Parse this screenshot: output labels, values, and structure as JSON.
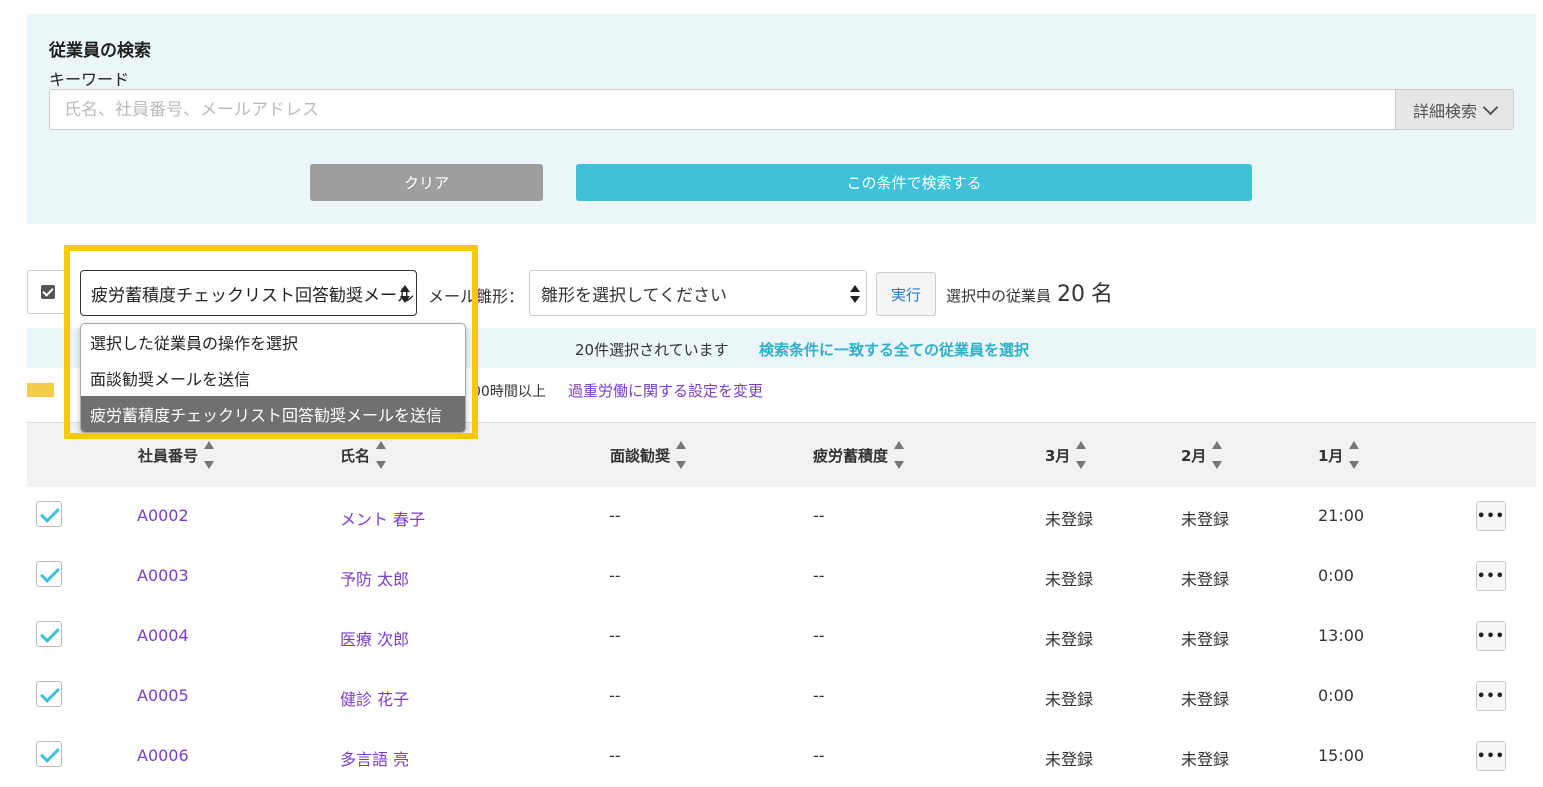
{
  "search": {
    "title": "従業員の検索",
    "keyword_label": "キーワード",
    "keyword_placeholder": "氏名、社員番号、メールアドレス",
    "keyword_value": "",
    "advanced_label": "詳細検索",
    "clear_label": "クリア",
    "submit_label": "この条件で検索する"
  },
  "bulk": {
    "action_selected": "疲労蓄積度チェックリスト回答勧奨メール",
    "template_label": "メール雛形：",
    "template_selected": "雛形を選択してください",
    "run_label": "実行",
    "selected_label": "選択中の従業員",
    "selected_count": "20",
    "selected_unit": "名"
  },
  "dropdown": {
    "options": [
      "選択した従業員の操作を選択",
      "面談勧奨メールを送信",
      "疲労蓄積度チェックリスト回答勧奨メールを送信"
    ],
    "selected_index": 2
  },
  "banner": {
    "text": "20件選択されています",
    "link": "検索条件に一致する全ての従業員を選択"
  },
  "legend": {
    "swatch_color": "#f2cc4a",
    "text": "00時間以上",
    "settings_link": "過重労働に関する設定を変更"
  },
  "table": {
    "columns": [
      "社員番号",
      "氏名",
      "面談勧奨",
      "疲労蓄積度",
      "3月",
      "2月",
      "1月"
    ],
    "rows": [
      {
        "id": "A0002",
        "name": "メント 春子",
        "interview": "--",
        "fatigue": "--",
        "mar": "未登録",
        "feb": "未登録",
        "jan": "21:00"
      },
      {
        "id": "A0003",
        "name": "予防 太郎",
        "interview": "--",
        "fatigue": "--",
        "mar": "未登録",
        "feb": "未登録",
        "jan": "0:00"
      },
      {
        "id": "A0004",
        "name": "医療 次郎",
        "interview": "--",
        "fatigue": "--",
        "mar": "未登録",
        "feb": "未登録",
        "jan": "13:00"
      },
      {
        "id": "A0005",
        "name": "健診 花子",
        "interview": "--",
        "fatigue": "--",
        "mar": "未登録",
        "feb": "未登録",
        "jan": "0:00"
      },
      {
        "id": "A0006",
        "name": "多言語 亮",
        "interview": "--",
        "fatigue": "--",
        "mar": "未登録",
        "feb": "未登録",
        "jan": "15:00"
      }
    ],
    "more_label": "•••"
  },
  "colors": {
    "accent": "#3ec1d9",
    "link": "#7a3fc4",
    "highlight": "#f8c900",
    "panel_bg": "#eaf6f8"
  }
}
